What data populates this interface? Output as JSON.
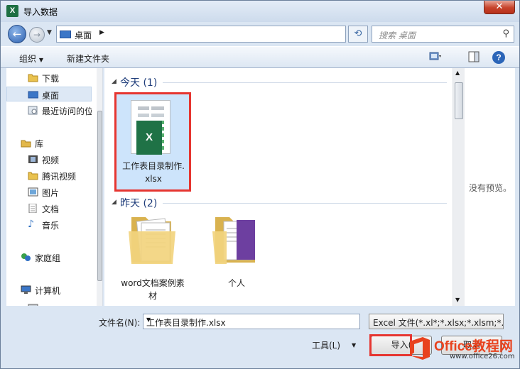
{
  "window": {
    "title": "导入数据",
    "app_icon": "X"
  },
  "nav": {
    "address": "桌面",
    "search_placeholder": "搜索 桌面"
  },
  "toolbar": {
    "organize": "组织",
    "new_folder": "新建文件夹"
  },
  "sidebar": {
    "items": [
      {
        "label": "下载",
        "icon": "download-folder-icon"
      },
      {
        "label": "桌面",
        "icon": "desktop-icon"
      },
      {
        "label": "最近访问的位",
        "icon": "recent-places-icon"
      },
      {
        "label": "库",
        "icon": "library-icon"
      },
      {
        "label": "视频",
        "icon": "video-icon"
      },
      {
        "label": "腾讯视频",
        "icon": "folder-icon"
      },
      {
        "label": "图片",
        "icon": "pictures-icon"
      },
      {
        "label": "文档",
        "icon": "documents-icon"
      },
      {
        "label": "音乐",
        "icon": "music-icon"
      },
      {
        "label": "家庭组",
        "icon": "homegroup-icon"
      },
      {
        "label": "计算机",
        "icon": "computer-icon"
      }
    ]
  },
  "groups": [
    {
      "label": "今天 (1)",
      "files": [
        {
          "name_line1": "工作表目录制作.",
          "name_line2": "xlsx"
        }
      ]
    },
    {
      "label": "昨天 (2)",
      "files": [
        {
          "name_line1": "word文档案例素",
          "name_line2": "材"
        },
        {
          "name_line1": "个人",
          "name_line2": ""
        }
      ]
    }
  ],
  "preview_text": "没有预览。",
  "bottom": {
    "filename_label": "文件名(N):",
    "filename_value": "工作表目录制作.xlsx",
    "filetype_value": "Excel 文件(*.xl*;*.xlsx;*.xlsm;*.",
    "tools_label": "工具(L)",
    "import_button": "导入(",
    "cancel_button": "取消"
  },
  "watermark": {
    "brand": "Office教程网",
    "url": "www.office26.com"
  },
  "colors": {
    "highlight": "#e63530",
    "selection": "#cde4fb",
    "excel_green": "#1f7246"
  }
}
